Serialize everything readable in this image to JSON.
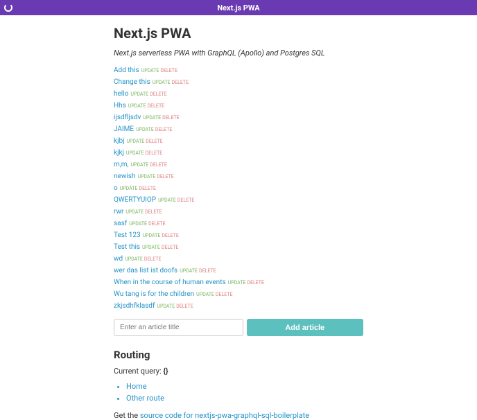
{
  "header": {
    "title": "Next.js PWA"
  },
  "page": {
    "heading": "Next.js PWA",
    "subtitle": "Next.js serverless PWA with GraphQL (Apollo) and Postgres SQL"
  },
  "action": {
    "update": "UPDATE",
    "delete": "DELETE"
  },
  "articles": [
    "Add this",
    "Change this",
    "hello",
    "Hhs",
    "ijsdfljsdv",
    "JAIME",
    "kjbj",
    "kjkj",
    "m,m,",
    "newish",
    "o",
    "QWERTYUIOP",
    "rwr",
    "sasf",
    "Test 123",
    "Test this",
    "wd",
    "wer das list ist doofs",
    "When in the course of human events",
    "Wu tang is for the children",
    "zkjsdhfklasdf"
  ],
  "form": {
    "placeholder": "Enter an article title",
    "button": "Add article"
  },
  "routing": {
    "heading": "Routing",
    "query_label": "Current query: ",
    "query_value": "{}",
    "links": [
      "Home",
      "Other route"
    ]
  },
  "footer": {
    "prefix": "Get the ",
    "linktext": "source code for nextjs-pwa-graphql-sql-boilerplate"
  }
}
